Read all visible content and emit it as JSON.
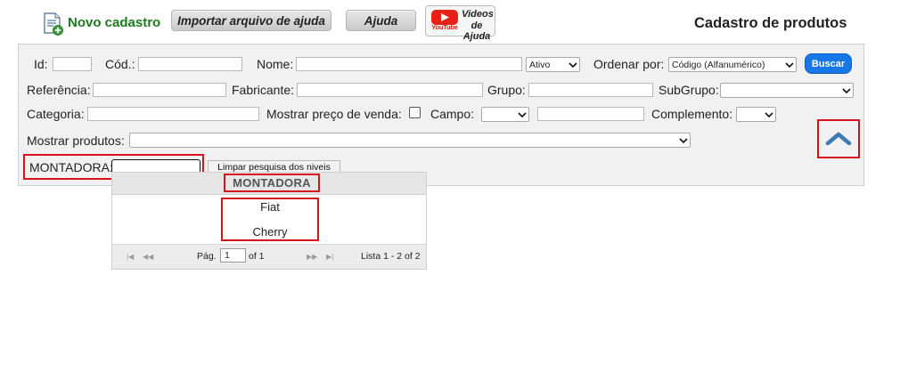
{
  "header": {
    "new_label": "Novo cadastro",
    "import_label": "Importar arquivo de ajuda",
    "help_label": "Ajuda",
    "video_line1": "Videos",
    "video_line2": "de Ajuda",
    "youtube_text": "YouTube",
    "page_title": "Cadastro de produtos"
  },
  "filters": {
    "id_label": "Id:",
    "cod_label": "Cód.:",
    "nome_label": "Nome:",
    "status_value": "Ativo",
    "ordenar_label": "Ordenar por:",
    "ordenar_value": "Código (Alfanumérico)",
    "buscar_label": "Buscar",
    "referencia_label": "Referência:",
    "fabricante_label": "Fabricante:",
    "grupo_label": "Grupo:",
    "subgrupo_label": "SubGrupo:",
    "categoria_label": "Categoria:",
    "mostrar_preco_label": "Mostrar preço de venda:",
    "campo_label": "Campo:",
    "complemento_label": "Complemento:",
    "mostrar_produtos_label": "Mostrar produtos:",
    "montadora_label": "MONTADORA:",
    "limpar_label": "Limpar pesquisa dos niveis"
  },
  "popup": {
    "column_header": "MONTADORA",
    "rows": [
      "Fiat",
      "Cherry"
    ],
    "page_label": "Pág.",
    "page_value": "1",
    "of_label": "of 1",
    "list_info": "Lista 1 - 2 of 2"
  },
  "colors": {
    "accent_blue": "#1677e8",
    "highlight_red": "#d6131d",
    "new_label_green": "#1e7a1e"
  }
}
